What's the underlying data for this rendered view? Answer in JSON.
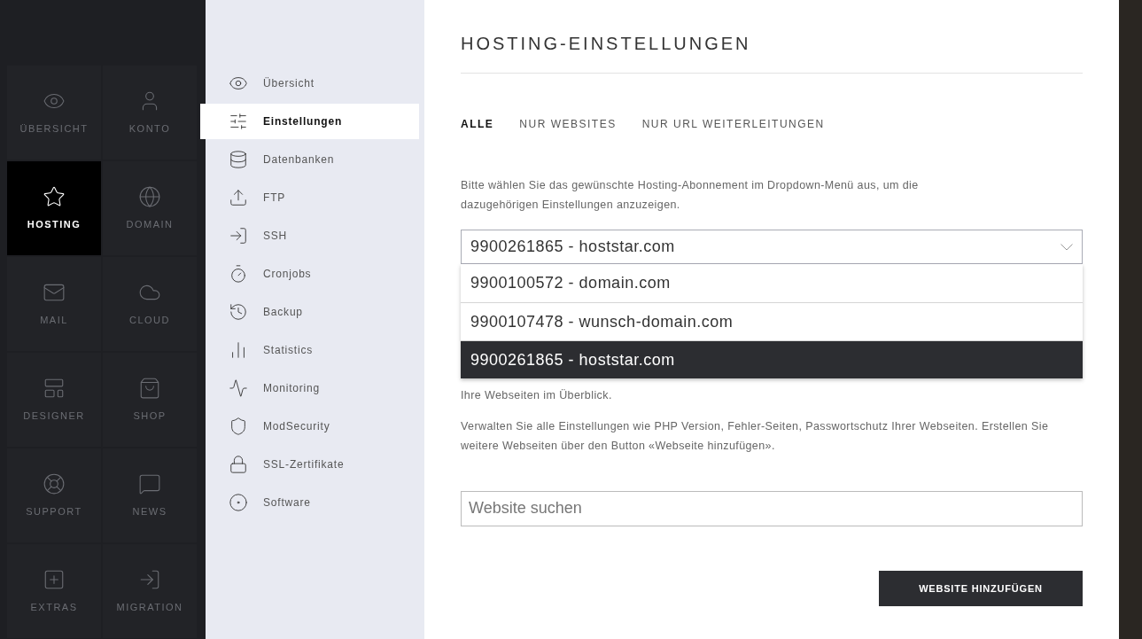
{
  "tiles": [
    {
      "label": "ÜBERSICHT",
      "selected": false
    },
    {
      "label": "KONTO",
      "selected": false
    },
    {
      "label": "HOSTING",
      "selected": true
    },
    {
      "label": "DOMAIN",
      "selected": false
    },
    {
      "label": "MAIL",
      "selected": false
    },
    {
      "label": "CLOUD",
      "selected": false
    },
    {
      "label": "DESIGNER",
      "selected": false
    },
    {
      "label": "SHOP",
      "selected": false
    },
    {
      "label": "SUPPORT",
      "selected": false
    },
    {
      "label": "NEWS",
      "selected": false
    },
    {
      "label": "EXTRAS",
      "selected": false
    },
    {
      "label": "MIGRATION",
      "selected": false
    }
  ],
  "submenu": [
    {
      "label": "Übersicht",
      "selected": false
    },
    {
      "label": "Einstellungen",
      "selected": true
    },
    {
      "label": "Datenbanken",
      "selected": false
    },
    {
      "label": "FTP",
      "selected": false
    },
    {
      "label": "SSH",
      "selected": false
    },
    {
      "label": "Cronjobs",
      "selected": false
    },
    {
      "label": "Backup",
      "selected": false
    },
    {
      "label": "Statistics",
      "selected": false
    },
    {
      "label": "Monitoring",
      "selected": false
    },
    {
      "label": "ModSecurity",
      "selected": false
    },
    {
      "label": "SSL-Zertifikate",
      "selected": false
    },
    {
      "label": "Software",
      "selected": false
    }
  ],
  "main": {
    "title": "HOSTING-EINSTELLUNGEN",
    "tabs": [
      {
        "label": "ALLE",
        "selected": true
      },
      {
        "label": "NUR WEBSITES",
        "selected": false
      },
      {
        "label": "NUR URL WEITERLEITUNGEN",
        "selected": false
      }
    ],
    "intro": "Bitte wählen Sie das gewünschte Hosting-Abonnement im Dropdown-Menü aus, um die dazugehörigen Einstellungen anzuzeigen.",
    "dropdown": {
      "value": "9900261865 - hoststar.com",
      "expanded": true,
      "options": [
        {
          "label": "9900100572 - domain.com",
          "selected": false
        },
        {
          "label": "9900107478 - wunsch-domain.com",
          "selected": false
        },
        {
          "label": "9900261865 - hoststar.com",
          "selected": true
        }
      ]
    },
    "overview": "Ihre Webseiten im Überblick.",
    "description": "Verwalten Sie alle Einstellungen wie PHP Version, Fehler-Seiten, Passwortschutz Ihrer Webseiten. Erstellen Sie weitere Webseiten über den Button «Webseite hinzufügen».",
    "search": {
      "placeholder": "Website suchen"
    },
    "add_button": "WEBSITE HINZUFÜGEN"
  }
}
